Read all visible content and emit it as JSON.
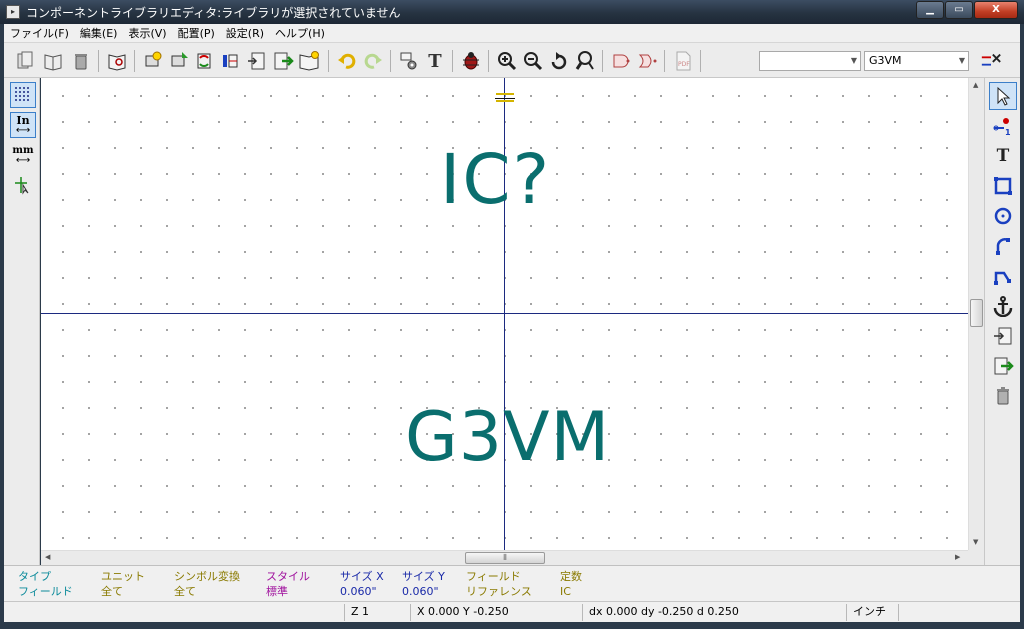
{
  "window": {
    "title": "コンポーネントライブラリエディタ:ライブラリが選択されていません",
    "app_icon": "kicad-app-icon",
    "controls": {
      "minimize": "▁",
      "maximize": "▭",
      "close": "X"
    }
  },
  "menu": [
    "ファイル(F)",
    "編集(E)",
    "表示(V)",
    "配置(P)",
    "設定(R)",
    "ヘルプ(H)"
  ],
  "toolbar": {
    "part_combo": "",
    "unit_combo": "G3VM",
    "icons": [
      "select-working-library-icon",
      "library-browse-icon",
      "delete-library-icon",
      "library-view-icon",
      "new-component-icon",
      "import-component-icon",
      "component-sync-icon",
      "pin-table-icon",
      "import-icon",
      "export-icon",
      "save-component-icon",
      "undo-icon",
      "redo-icon",
      "document-settings-icon",
      "text-icon",
      "erc-check-icon",
      "zoom-in-icon",
      "zoom-out-icon",
      "zoom-redraw-icon",
      "zoom-fit-icon",
      "body-style-normal-icon",
      "body-style-deMorgan-icon",
      "pdf-datasheet-icon",
      "pin-edit-icon"
    ]
  },
  "left_toolbar": {
    "grid_icon": "grid-icon",
    "inch_label": "In",
    "mm_label": "mm",
    "cursor_icon": "cursor-shape-icon"
  },
  "right_toolbar": [
    "select-arrow-icon",
    "add-pin-icon",
    "add-text-icon",
    "add-rectangle-icon",
    "add-circle-icon",
    "add-arc-icon",
    "add-polyline-icon",
    "anchor-icon",
    "import-drawing-icon",
    "export-drawing-icon",
    "delete-item-icon"
  ],
  "canvas": {
    "reference_field": "IC?",
    "value_field": "G3VM"
  },
  "message_panel": {
    "columns": [
      {
        "label": "タイプ",
        "value": "フィールド"
      },
      {
        "label": "ユニット",
        "value": "全て"
      },
      {
        "label": "シンボル変換",
        "value": "全て"
      },
      {
        "label": "スタイル",
        "value": "標準"
      },
      {
        "label": "サイズ X",
        "value": "0.060\""
      },
      {
        "label": "サイズ Y",
        "value": "0.060\""
      },
      {
        "label": "フィールド",
        "value": "リファレンス"
      },
      {
        "label": "定数",
        "value": "IC"
      }
    ]
  },
  "status_bar": {
    "zoom": "Z 1",
    "cursor": "X 0.000  Y -0.250",
    "delta": "dx 0.000  dy -0.250  d 0.250",
    "units": "インチ"
  },
  "colors": {
    "field_text": "#0a6e6e",
    "axis": "#1c2a80",
    "anchor": "#d4b400"
  }
}
